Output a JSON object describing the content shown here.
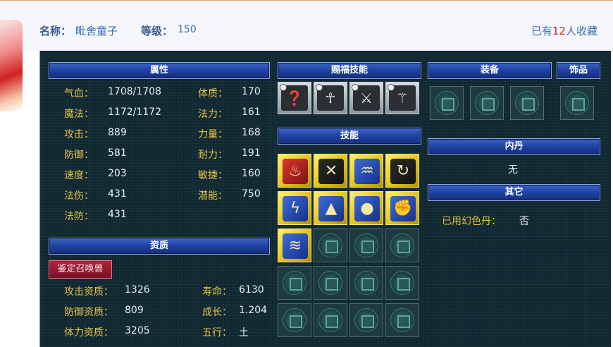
{
  "header": {
    "name_label": "名称：",
    "name_value": "毗舍童子",
    "level_label": "等级：",
    "level_value": "150",
    "favorites_prefix": "已有",
    "favorites_count": "12",
    "favorites_suffix": "人收藏"
  },
  "sections": {
    "attributes": "属性",
    "blessing_skills": "赐福技能",
    "skills": "技能",
    "equipment": "装备",
    "accessory": "饰品",
    "neidan": "内丹",
    "other": "其它",
    "aptitude": "资质"
  },
  "attributes": [
    {
      "label": "气血：",
      "value": "1708/1708"
    },
    {
      "label": "魔法：",
      "value": "1172/1172"
    },
    {
      "label": "攻击：",
      "value": "889"
    },
    {
      "label": "防御：",
      "value": "581"
    },
    {
      "label": "速度：",
      "value": "203"
    },
    {
      "label": "法伤：",
      "value": "431"
    },
    {
      "label": "法防：",
      "value": "431"
    },
    {
      "label": "体质：",
      "value": "170"
    },
    {
      "label": "法力：",
      "value": "161"
    },
    {
      "label": "力量：",
      "value": "168"
    },
    {
      "label": "耐力：",
      "value": "191"
    },
    {
      "label": "敏捷：",
      "value": "160"
    },
    {
      "label": "潜能：",
      "value": "750"
    }
  ],
  "identify_button": "鉴定召唤兽",
  "aptitude": [
    {
      "label": "攻击资质：",
      "value": "1326"
    },
    {
      "label": "防御资质：",
      "value": "809"
    },
    {
      "label": "体力资质：",
      "value": "3205"
    },
    {
      "label": "寿命：",
      "value": "6130"
    },
    {
      "label": "成长：",
      "value": "1.204"
    },
    {
      "label": "五行：",
      "value": "土"
    }
  ],
  "neidan_value": "无",
  "other": {
    "label": "已用幻色丹：",
    "value": "否"
  },
  "icons": {
    "empty_slot": "emblem-icon",
    "blessing": [
      "question-bubble-icon",
      "figure-icon",
      "shield-axe-icon",
      "weapon-icon"
    ],
    "skills": [
      "fire-figure-icon",
      "crossbow-icon",
      "dragon-icon",
      "hook-icon",
      "lightning-icon",
      "hooded-figure-icon",
      "silhouette-icon",
      "fist-icon",
      "claw-icon"
    ]
  }
}
